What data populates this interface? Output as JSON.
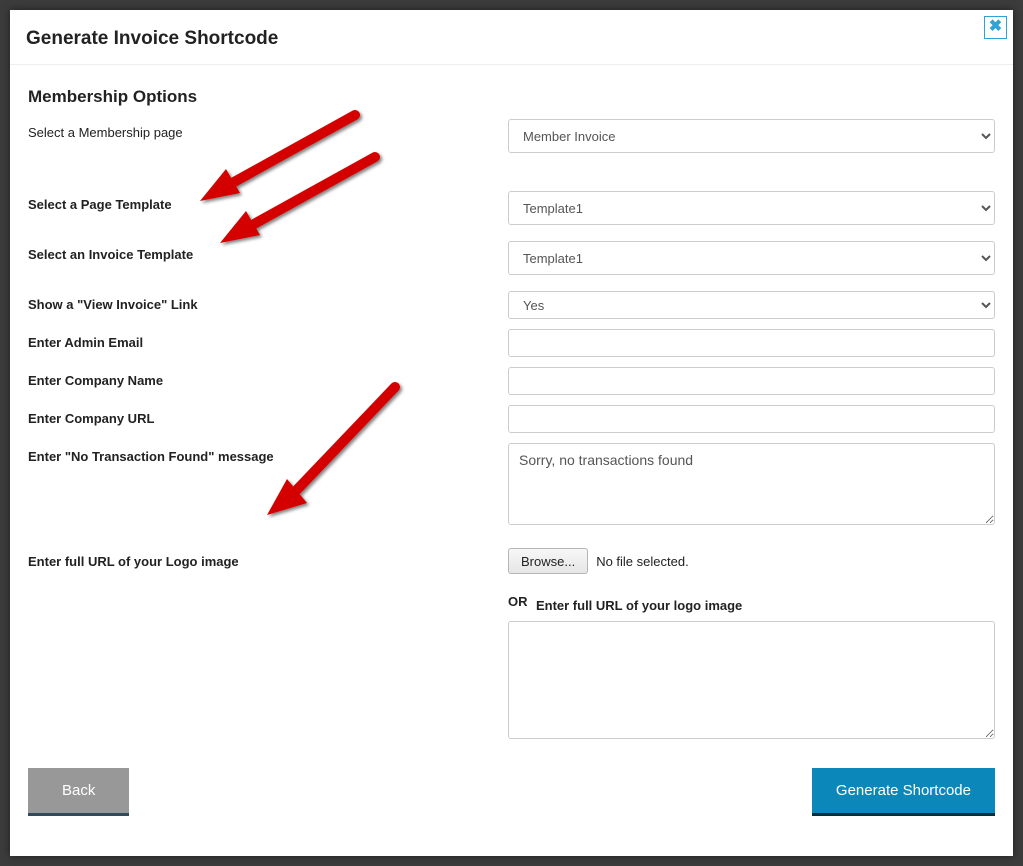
{
  "modal": {
    "title": "Generate Invoice Shortcode",
    "close_icon": "✖"
  },
  "section": {
    "title": "Membership Options"
  },
  "labels": {
    "membership_page": "Select a Membership page",
    "page_template": "Select a Page Template",
    "invoice_template": "Select an Invoice Template",
    "view_invoice_link": "Show a \"View Invoice\" Link",
    "admin_email": "Enter Admin Email",
    "company_name": "Enter Company Name",
    "company_url": "Enter Company URL",
    "no_transaction_msg": "Enter \"No Transaction Found\" message",
    "logo_url": "Enter full URL of your Logo image",
    "or": "OR",
    "logo_url_sub": "Enter full URL of your logo image"
  },
  "values": {
    "membership_page": "Member Invoice",
    "page_template": "Template1",
    "invoice_template": "Template1",
    "view_invoice_link": "Yes",
    "admin_email": "",
    "company_name": "",
    "company_url": "",
    "no_transaction_msg": "Sorry, no transactions found",
    "logo_url_text": ""
  },
  "file": {
    "browse_label": "Browse...",
    "status": "No file selected."
  },
  "buttons": {
    "back": "Back",
    "generate": "Generate Shortcode"
  }
}
